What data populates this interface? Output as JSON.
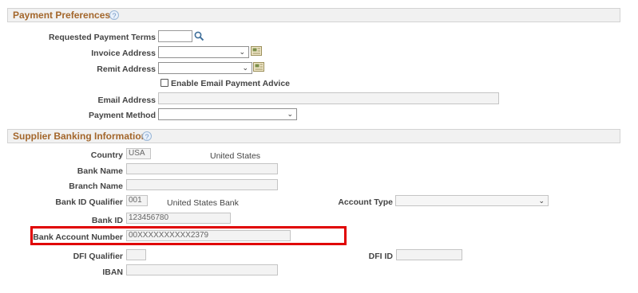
{
  "payment_preferences": {
    "title": "Payment Preferences",
    "help_icon": "help-icon",
    "requested_payment_terms": {
      "label": "Requested Payment Terms",
      "value": ""
    },
    "invoice_address": {
      "label": "Invoice Address",
      "value": ""
    },
    "remit_address": {
      "label": "Remit Address",
      "value": ""
    },
    "enable_email_payment_advice": {
      "label": "Enable Email Payment Advice",
      "checked": false
    },
    "email_address": {
      "label": "Email Address",
      "value": ""
    },
    "payment_method": {
      "label": "Payment Method",
      "value": ""
    }
  },
  "supplier_banking": {
    "title": "Supplier Banking Information",
    "country": {
      "label": "Country",
      "value": "USA",
      "description": "United States"
    },
    "bank_name": {
      "label": "Bank Name",
      "value": ""
    },
    "branch_name": {
      "label": "Branch Name",
      "value": ""
    },
    "bank_id_qualifier": {
      "label": "Bank ID Qualifier",
      "value": "001",
      "description": "United States Bank"
    },
    "account_type": {
      "label": "Account Type",
      "value": ""
    },
    "bank_id": {
      "label": "Bank ID",
      "value": "123456780"
    },
    "bank_account_number": {
      "label": "Bank Account Number",
      "value": "00XXXXXXXXXX2379"
    },
    "dfi_qualifier": {
      "label": "DFI Qualifier",
      "value": ""
    },
    "dfi_id": {
      "label": "DFI ID",
      "value": ""
    },
    "iban": {
      "label": "IBAN",
      "value": ""
    }
  },
  "colors": {
    "section_title": "#a3662b",
    "highlight": "#e00000",
    "section_bar": "#f1f1f1"
  }
}
